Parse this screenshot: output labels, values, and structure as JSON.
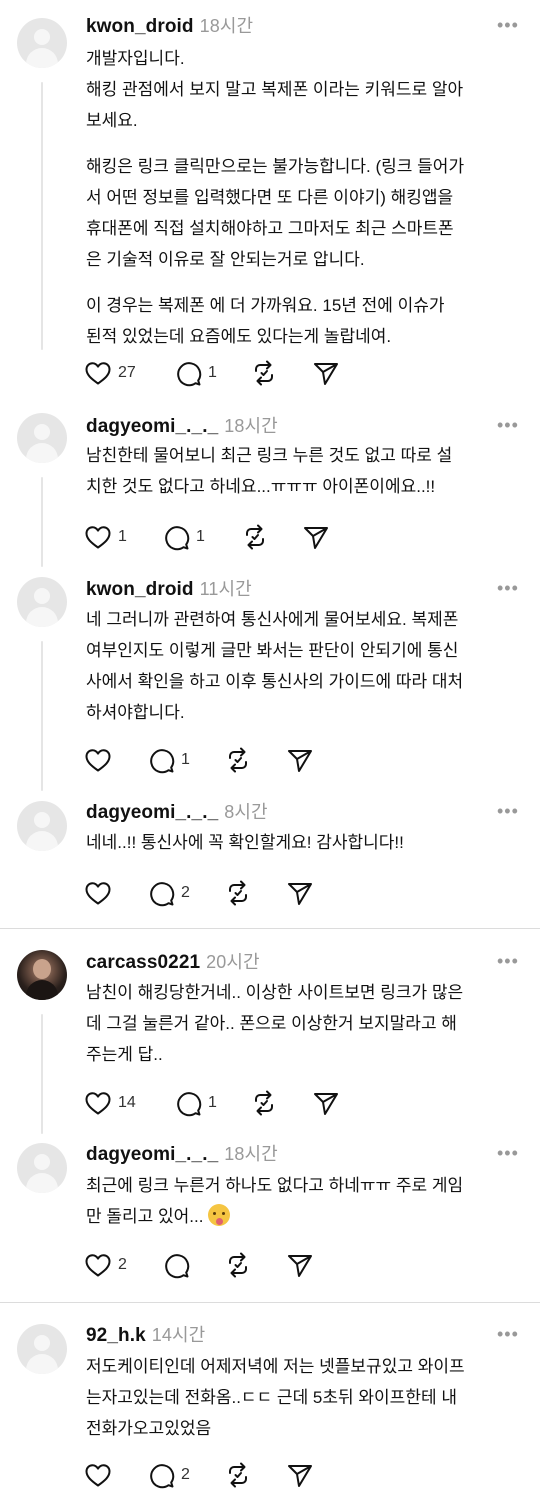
{
  "comments": [
    {
      "username": "kwon_droid",
      "time": "18시간",
      "paragraphs": [
        "개발자입니다.\n해킹 관점에서 보지 말고 복제폰 이라는 키워드로 알아\n보세요.",
        "해킹은 링크 클릭만으로는 불가능합니다. (링크 들어가\n서 어떤 정보를 입력했다면 또 다른 이야기) 해킹앱을\n휴대폰에 직접 설치해야하고 그마저도 최근 스마트폰\n은 기술적 이유로 잘 안되는거로 압니다.",
        "이 경우는 복제폰 에 더 가까워요. 15년 전에 이슈가\n된적 있었는데 요즘에도 있다는게 놀랍네여."
      ],
      "likes": "27",
      "replies": "1"
    },
    {
      "username": "dagyeomi_._._",
      "time": "18시간",
      "paragraphs": [
        "남친한테 물어보니 최근 링크 누른 것도 없고 따로 설\n치한 것도 없다고 하네요...ㅠㅠㅠ 아이폰이에요..!!"
      ],
      "likes": "1",
      "replies": "1"
    },
    {
      "username": "kwon_droid",
      "time": "11시간",
      "paragraphs": [
        "네 그러니까 관련하여 통신사에게 물어보세요. 복제폰\n여부인지도 이렇게 글만 봐서는 판단이 안되기에 통신\n사에서 확인을 하고 이후 통신사의 가이드에 따라 대처\n하셔야합니다."
      ],
      "likes": "",
      "replies": "1"
    },
    {
      "username": "dagyeomi_._._",
      "time": "8시간",
      "paragraphs": [
        "네네..!! 통신사에 꼭 확인할게요! 감사합니다!!"
      ],
      "likes": "",
      "replies": "2"
    },
    {
      "username": "carcass0221",
      "time": "20시간",
      "paragraphs": [
        "남친이 해킹당한거네.. 이상한 사이트보면 링크가 많은\n데 그걸 눌른거 같아.. 폰으로 이상한거 보지말라고 해\n주는게 답.."
      ],
      "likes": "14",
      "replies": "1"
    },
    {
      "username": "dagyeomi_._._",
      "time": "18시간",
      "paragraphs": [
        "최근에 링크 누른거 하나도 없다고 하네ㅠㅠ 주로 게임\n만 돌리고 있어..."
      ],
      "emoji": "drooling-face-emoji",
      "likes": "2",
      "replies": ""
    },
    {
      "username": "92_h.k",
      "time": "14시간",
      "paragraphs": [
        "저도케이티인데 어제저녁에 저는 넷플보규있고 와이프\n는자고있는데 전화옴..ㄷㄷ 근데 5초뒤 와이프한테 내\n전화가오고있었음"
      ],
      "likes": "",
      "replies": "2"
    }
  ],
  "more_label": "•••",
  "icons": [
    "heart-icon",
    "comment-icon",
    "repost-icon",
    "share-icon"
  ]
}
